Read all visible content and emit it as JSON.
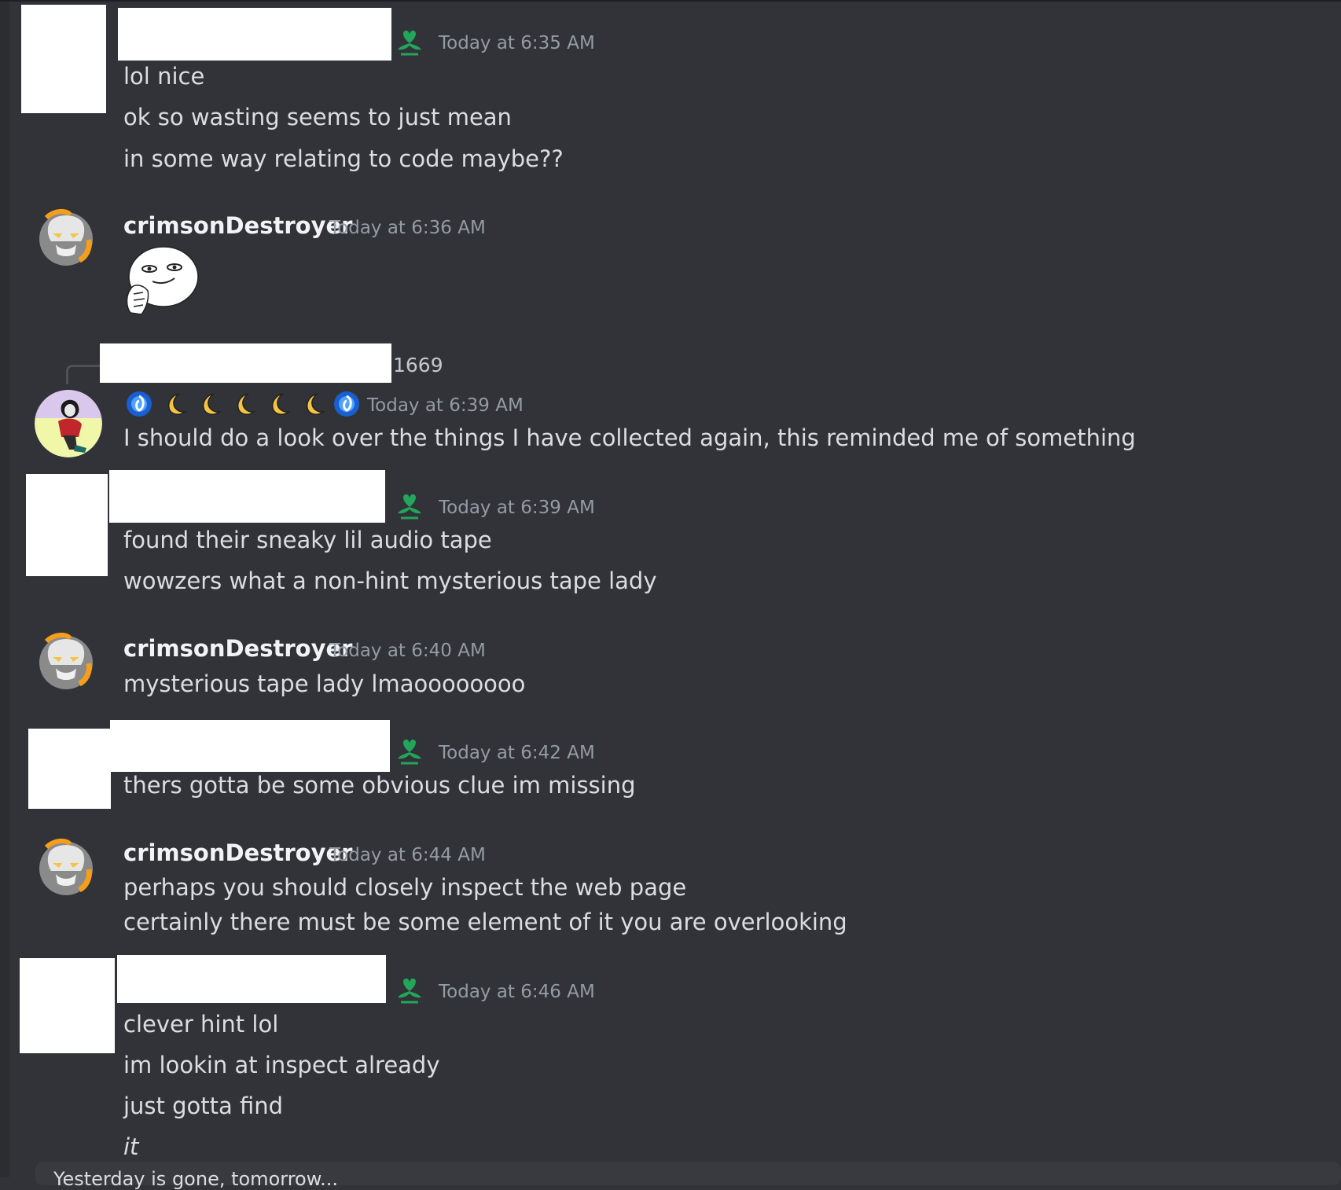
{
  "messages": [
    {
      "author": "",
      "timestamp": "Today at 6:35 AM",
      "lines": [
        "lol nice",
        "ok so wasting seems to just mean",
        "in some way relating to code maybe??"
      ]
    },
    {
      "author": "crimsonDestroyer",
      "timestamp": "Today at 6:36 AM",
      "sticker": "thinking-face-sticker"
    },
    {
      "reply_to_count": "1669",
      "author_emoji": [
        "blue-swirl",
        "moon",
        "moon",
        "moon",
        "moon",
        "moon",
        "blue-swirl"
      ],
      "timestamp": "Today at 6:39 AM",
      "lines": [
        "I should do a look over the things I have collected again, this reminded me of something"
      ]
    },
    {
      "author": "",
      "timestamp": "Today at 6:39 AM",
      "lines": [
        "found their sneaky lil audio tape",
        "wowzers what a non-hint mysterious tape lady"
      ]
    },
    {
      "author": "crimsonDestroyer",
      "timestamp": "Today at 6:40 AM",
      "lines": [
        "mysterious tape lady lmaoooooooo"
      ]
    },
    {
      "author": "",
      "timestamp": "Today at 6:42 AM",
      "lines": [
        "thers gotta be some obvious clue im missing"
      ]
    },
    {
      "author": "crimsonDestroyer",
      "timestamp": "Today at 6:44 AM",
      "lines": [
        "perhaps you should closely inspect the web page",
        "certainly there must be some element of it you are overlooking"
      ]
    },
    {
      "author": "",
      "timestamp": "Today at 6:46 AM",
      "lines": [
        "clever hint lol",
        "im lookin at inspect already",
        "just gotta find",
        "it"
      ]
    }
  ],
  "input": {
    "placeholder": "Yesterday is gone, tomorrow..."
  },
  "colors": {
    "background": "#313338",
    "badge": "#23a55a",
    "username": "#f2f3f5",
    "timestamp": "#949ba4"
  },
  "icons": [
    "heart-plant-badge-icon",
    "avatar-troll",
    "avatar-girl",
    "blue-swirl-emoji",
    "moon-emoji"
  ]
}
